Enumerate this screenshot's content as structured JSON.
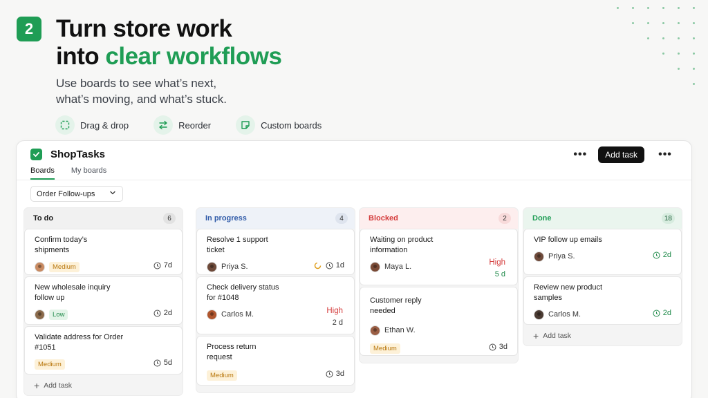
{
  "hero": {
    "step_number": "2",
    "headline_line1": "Turn store work",
    "headline_line2_prefix": "into ",
    "headline_line2_accent": "clear workflows",
    "subhead_line1": "Use boards to see what’s next,",
    "subhead_line2": "what’s moving, and what’s stuck.",
    "accent_color": "#1f9d55"
  },
  "features": [
    {
      "label": "Drag & drop",
      "icon": "drag-icon"
    },
    {
      "label": "Reorder",
      "icon": "reorder-icon"
    },
    {
      "label": "Custom boards",
      "icon": "custom-board-icon"
    }
  ],
  "app": {
    "title": "ShopTasks",
    "add_task_label": "Add task",
    "more_label": "•••",
    "tabs": [
      {
        "label": "Boards",
        "active": true
      },
      {
        "label": "My boards",
        "active": false
      }
    ],
    "board_select_value": "Order Follow-ups"
  },
  "columns": {
    "todo": {
      "title": "To do",
      "count": "6",
      "cards": [
        {
          "title": "Confirm today’s shipments",
          "priority": "Medium",
          "due": "7d"
        },
        {
          "title": "New wholesale inquiry follow up",
          "priority": "Low",
          "due": "2d"
        },
        {
          "title": "Validate address for Order #1051",
          "priority": "Medium",
          "due": "5d"
        }
      ],
      "add_label": "Add task"
    },
    "progress": {
      "title": "In progress",
      "count": "4",
      "cards": [
        {
          "title": "Resolve 1 support ticket",
          "assignee": "Priya S.",
          "due": "1d"
        },
        {
          "title": "Check delivery status for #1048",
          "assignee": "Carlos M.",
          "priority": "High",
          "due": "2 d"
        },
        {
          "title": "Process return request",
          "priority": "Medium",
          "due": "3d"
        }
      ]
    },
    "blocked": {
      "title": "Blocked",
      "count": "2",
      "cards": [
        {
          "title": "Waiting on product information",
          "assignee": "Maya L.",
          "priority": "High",
          "due": "5 d"
        },
        {
          "title": "Customer reply needed",
          "assignee": "Ethan W.",
          "priority": "Medium",
          "due": "3d"
        }
      ]
    },
    "done": {
      "title": "Done",
      "count": "18",
      "cards": [
        {
          "title": "VIP follow up emails",
          "assignee": "Priya S.",
          "due": "2d"
        },
        {
          "title": "Review new product samples",
          "assignee": "Carlos M.",
          "due": "2d"
        }
      ],
      "add_label": "Add task"
    }
  }
}
